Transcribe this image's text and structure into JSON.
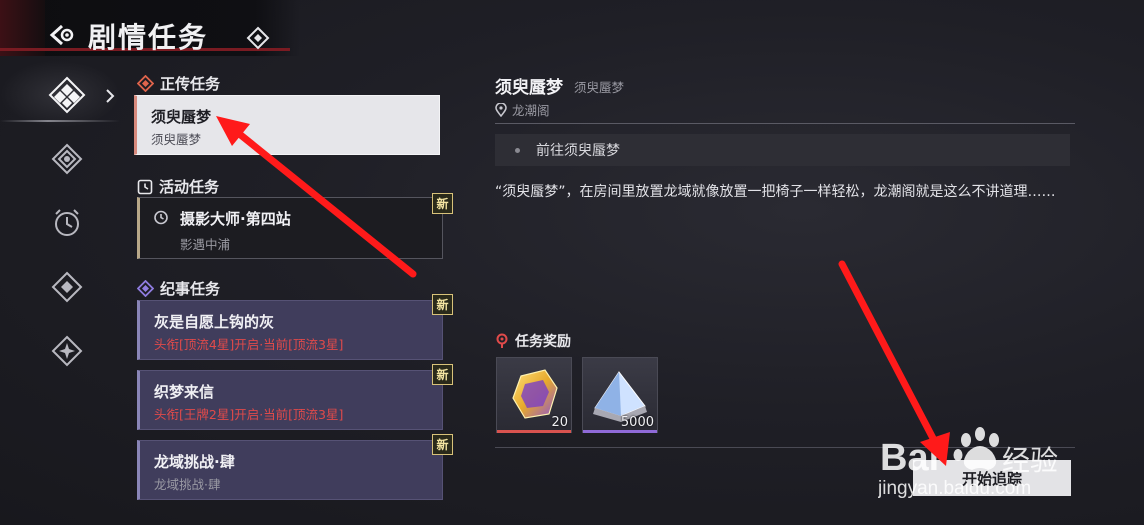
{
  "header": {
    "title": "剧情任务"
  },
  "sections": {
    "main": {
      "label": "正传任务"
    },
    "event": {
      "label": "活动任务"
    },
    "chronicle": {
      "label": "纪事任务"
    }
  },
  "quests": {
    "main_1": {
      "name": "须臾蜃梦",
      "sub": "须臾蜃梦"
    },
    "event_1": {
      "name": "摄影大师·第四站",
      "sub": "影遇中浦",
      "badge": "新"
    },
    "chron_1": {
      "name": "灰是自愿上钩的灰",
      "sub": "头衔[顶流4星]开启·当前[顶流3星]",
      "badge": "新"
    },
    "chron_2": {
      "name": "织梦来信",
      "sub": "头衔[王牌2星]开启·当前[顶流3星]",
      "badge": "新"
    },
    "chron_3": {
      "name": "龙域挑战·肆",
      "sub": "龙域挑战·肆",
      "badge": "新"
    }
  },
  "detail": {
    "title": "须臾蜃梦",
    "subtitle": "须臾蜃梦",
    "location": "龙潮阁",
    "objective": "前往须臾蜃梦",
    "description": "“须臾蜃梦”，在房间里放置龙域就像放置一把椅子一样轻松，龙潮阁就是这么不讲道理……",
    "reward_label": "任务奖励",
    "rewards": [
      {
        "icon": "gold-crystal-icon",
        "qty": "20",
        "bar_color": "#d9534f"
      },
      {
        "icon": "silver-pyramid-icon",
        "qty": "5000",
        "bar_color": "#8f6ad8"
      }
    ],
    "start_button": "开始追踪"
  },
  "watermark": {
    "brand": "Bai",
    "brand_cn": "经验",
    "url": "jingyan.baidu.com"
  },
  "colors": {
    "accent_red": "#e04a4a",
    "arrow_red": "#ff1a1a",
    "badge_gold": "#d8c27a"
  }
}
